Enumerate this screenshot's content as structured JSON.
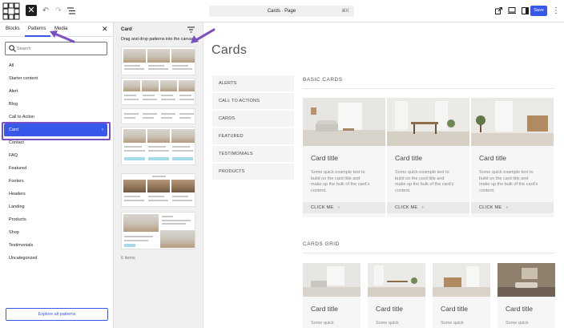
{
  "toolbar": {
    "command_bar": "Cards · Page",
    "shortcut": "⌘K",
    "save_label": "Save"
  },
  "inserter": {
    "tabs": [
      "Blocks",
      "Patterns",
      "Media"
    ],
    "search_placeholder": "Search",
    "categories": [
      "All",
      "Starter content",
      "Alert",
      "Blog",
      "Call to Action",
      "Card",
      "Contact",
      "FAQ",
      "Featured",
      "Footers",
      "Headers",
      "Landing",
      "Products",
      "Shop",
      "Testimonials",
      "Uncategorized"
    ],
    "selected_category": "Card",
    "explore_label": "Explore all patterns"
  },
  "patterns_panel": {
    "title": "Card",
    "description": "Drag and drop patterns into the canvas.",
    "count_label": "6 items"
  },
  "canvas": {
    "page_title": "Cards",
    "side_nav": [
      "ALERTS",
      "CALL TO ACTIONS",
      "CARDS",
      "FEATURED",
      "TESTIMONIALS",
      "PRODUCTS"
    ],
    "basic_heading": "BASIC CARDS",
    "grid_heading": "CARDS GRID",
    "card_title": "Card title",
    "card_text_lines": [
      "Some quick example text to",
      "build on the card title and",
      "make up the bulk of the card's",
      "content."
    ],
    "card_button": "CLICK ME",
    "grid_text": "Some quick"
  },
  "colors": {
    "accent": "#3858e9",
    "annotation": "#7b4fc4"
  }
}
